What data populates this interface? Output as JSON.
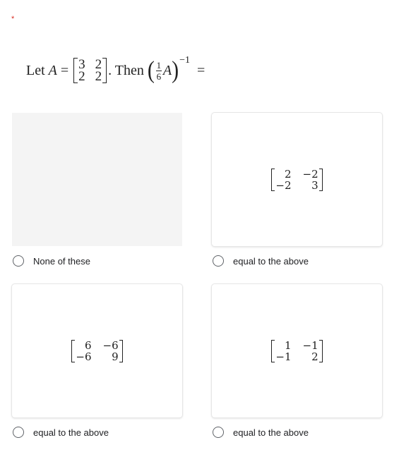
{
  "question": {
    "required_marker": "*",
    "prefix": "Let",
    "variable": "A",
    "equals": "=",
    "matrix": [
      [
        "3",
        "2"
      ],
      [
        "2",
        "2"
      ]
    ],
    "then_text": ". Then",
    "fraction": {
      "numerator": "1",
      "denominator": "6"
    },
    "exponent": "−1",
    "trailing_equals": "="
  },
  "options": [
    {
      "label": "None of these",
      "has_image": false,
      "matrix": null
    },
    {
      "label": "equal to the above",
      "has_image": true,
      "matrix": [
        [
          "2",
          "−2"
        ],
        [
          "−2",
          "3"
        ]
      ]
    },
    {
      "label": "equal to the above",
      "has_image": true,
      "matrix": [
        [
          "6",
          "−6"
        ],
        [
          "−6",
          "9"
        ]
      ]
    },
    {
      "label": "equal to the above",
      "has_image": true,
      "matrix": [
        [
          "1",
          "−1"
        ],
        [
          "−1",
          "2"
        ]
      ]
    }
  ],
  "colors": {
    "required": "#d93025",
    "empty_image": "#f4f4f4",
    "radio_border": "#5f6368"
  }
}
